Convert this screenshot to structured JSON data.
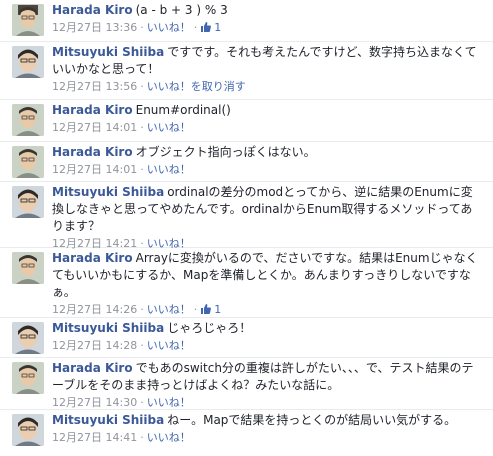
{
  "accent": "#3b5998",
  "comments": [
    {
      "author": "Harada Kiro",
      "text": "(a - b + 3 ) % 3",
      "time": "12月27日 13:36",
      "actions": [
        "いいね！"
      ],
      "likes": "1"
    },
    {
      "author": "Mitsuyuki Shiiba",
      "text": "ですです。それも考えたんですけど、数字持ち込まなくていいかなと思って！",
      "time": "12月27日 13:56",
      "actions": [
        "いいね！を取り消す"
      ],
      "likes": ""
    },
    {
      "author": "Harada Kiro",
      "text": "Enum#ordinal()",
      "time": "12月27日 14:01",
      "actions": [
        "いいね！"
      ],
      "likes": ""
    },
    {
      "author": "Harada Kiro",
      "text": "オブジェクト指向っぽくはない。",
      "time": "12月27日 14:01",
      "actions": [
        "いいね！"
      ],
      "likes": ""
    },
    {
      "author": "Mitsuyuki Shiiba",
      "text": "ordinalの差分のmodとってから、逆に結果のEnumに変換しなきゃと思ってやめたんです。ordinalからEnum取得するメソッドってあります？",
      "time": "12月27日 14:21",
      "actions": [
        "いいね！"
      ],
      "likes": ""
    },
    {
      "author": "Harada Kiro",
      "text": "Arrayに変換がいるので、ださいですな。結果はEnumじゃなくてもいいかもにするか、Mapを準備しとくか。あんまりすっきりしないですなぁ。",
      "time": "12月27日 14:26",
      "actions": [
        "いいね！"
      ],
      "likes": "1"
    },
    {
      "author": "Mitsuyuki Shiiba",
      "text": "じゃろじゃろ！",
      "time": "12月27日 14:28",
      "actions": [
        "いいね！"
      ],
      "likes": ""
    },
    {
      "author": "Harada Kiro",
      "text": "でもあのswitch分の重複は許しがたい、、、で、テスト結果のテーブルをそのまま持っとけばよくね？みたいな話に。",
      "time": "12月27日 14:30",
      "actions": [
        "いいね！"
      ],
      "likes": ""
    },
    {
      "author": "Mitsuyuki Shiiba",
      "text": "ねー。Mapで結果を持っとくのが結局いい気がする。",
      "time": "12月27日 14:41",
      "actions": [
        "いいね！"
      ],
      "likes": ""
    }
  ]
}
